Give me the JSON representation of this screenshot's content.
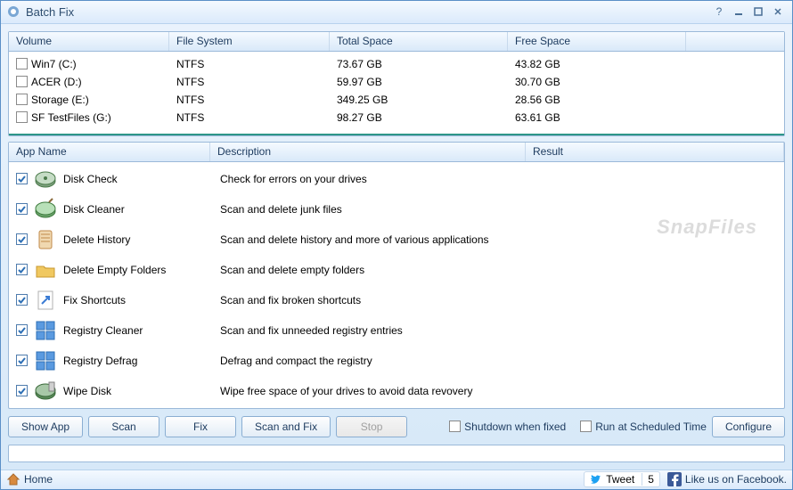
{
  "window": {
    "title": "Batch Fix"
  },
  "volumes": {
    "headers": {
      "volume": "Volume",
      "fs": "File System",
      "total": "Total Space",
      "free": "Free Space"
    },
    "rows": [
      {
        "name": "Win7 (C:)",
        "fs": "NTFS",
        "total": "73.67 GB",
        "free": "43.82 GB"
      },
      {
        "name": "ACER (D:)",
        "fs": "NTFS",
        "total": "59.97 GB",
        "free": "30.70 GB"
      },
      {
        "name": "Storage (E:)",
        "fs": "NTFS",
        "total": "349.25 GB",
        "free": "28.56 GB"
      },
      {
        "name": "SF TestFiles (G:)",
        "fs": "NTFS",
        "total": "98.27 GB",
        "free": "63.61 GB"
      }
    ]
  },
  "apps": {
    "headers": {
      "name": "App Name",
      "desc": "Description",
      "result": "Result"
    },
    "rows": [
      {
        "name": "Disk Check",
        "desc": "Check for errors on your drives",
        "icon_color": "#7da07d"
      },
      {
        "name": "Disk Cleaner",
        "desc": "Scan and delete junk files",
        "icon_color": "#6aa36a"
      },
      {
        "name": "Delete History",
        "desc": "Scan and delete history and more of various applications",
        "icon_color": "#d88a3f"
      },
      {
        "name": "Delete Empty Folders",
        "desc": "Scan and delete empty folders",
        "icon_color": "#e8b04a"
      },
      {
        "name": "Fix Shortcuts",
        "desc": "Scan and fix broken shortcuts",
        "icon_color": "#f0f0f0"
      },
      {
        "name": "Registry Cleaner",
        "desc": "Scan and fix unneeded registry entries",
        "icon_color": "#3b7cd4"
      },
      {
        "name": "Registry Defrag",
        "desc": "Defrag and compact the registry",
        "icon_color": "#3b7cd4"
      },
      {
        "name": "Wipe Disk",
        "desc": "Wipe free space of your drives to avoid data revovery",
        "icon_color": "#5a8a5a"
      }
    ]
  },
  "buttons": {
    "show_app": "Show App",
    "scan": "Scan",
    "fix": "Fix",
    "scan_fix": "Scan and Fix",
    "stop": "Stop",
    "configure": "Configure"
  },
  "options": {
    "shutdown": "Shutdown when fixed",
    "scheduled": "Run at Scheduled Time"
  },
  "statusbar": {
    "home": "Home",
    "tweet": "Tweet",
    "tweet_count": "5",
    "facebook": "Like us on Facebook."
  },
  "watermark": "SnapFiles"
}
